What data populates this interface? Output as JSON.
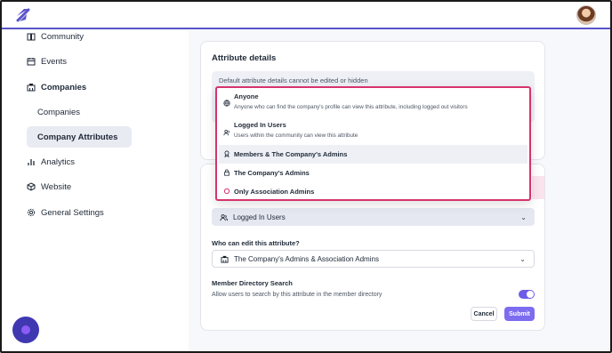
{
  "sidebar": {
    "items": [
      {
        "label": "Community",
        "icon": "book-icon"
      },
      {
        "label": "Events",
        "icon": "calendar-icon"
      },
      {
        "label": "Companies",
        "icon": "building-icon"
      },
      {
        "label": "Companies",
        "icon": ""
      },
      {
        "label": "Company Attributes",
        "icon": ""
      },
      {
        "label": "Analytics",
        "icon": "bar-chart-icon"
      },
      {
        "label": "Website",
        "icon": "cube-icon"
      },
      {
        "label": "General Settings",
        "icon": "gear-icon"
      }
    ]
  },
  "attribute_details": {
    "title": "Attribute details",
    "notice": "Default attribute details cannot be edited or hidden"
  },
  "visibility_dropdown": {
    "options": [
      {
        "label": "Anyone",
        "description": "Anyone who can find the company's profile can view this attribute, including logged out visitors",
        "icon": "globe-icon"
      },
      {
        "label": "Logged In Users",
        "description": "Users within the community can view this attribute",
        "icon": "users-icon"
      },
      {
        "label": "Members & The Company's Admins",
        "description": "",
        "icon": "award-icon"
      },
      {
        "label": "The Company's Admins",
        "description": "",
        "icon": "lock-icon"
      },
      {
        "label": "Only Association Admins",
        "description": "",
        "icon": "circle-icon"
      }
    ]
  },
  "form": {
    "view_select_value": "Logged In Users",
    "edit_label": "Who can edit this attribute?",
    "edit_select_value": "The Company's Admins & Association Admins",
    "search_label": "Member Directory Search",
    "search_help": "Allow users to search by this attribute in the member directory",
    "search_enabled": true,
    "cancel_label": "Cancel",
    "submit_label": "Submit"
  },
  "colors": {
    "accent": "#7c6cf0",
    "highlight_border": "#d6336c",
    "topbar_line": "#5b54c9"
  }
}
